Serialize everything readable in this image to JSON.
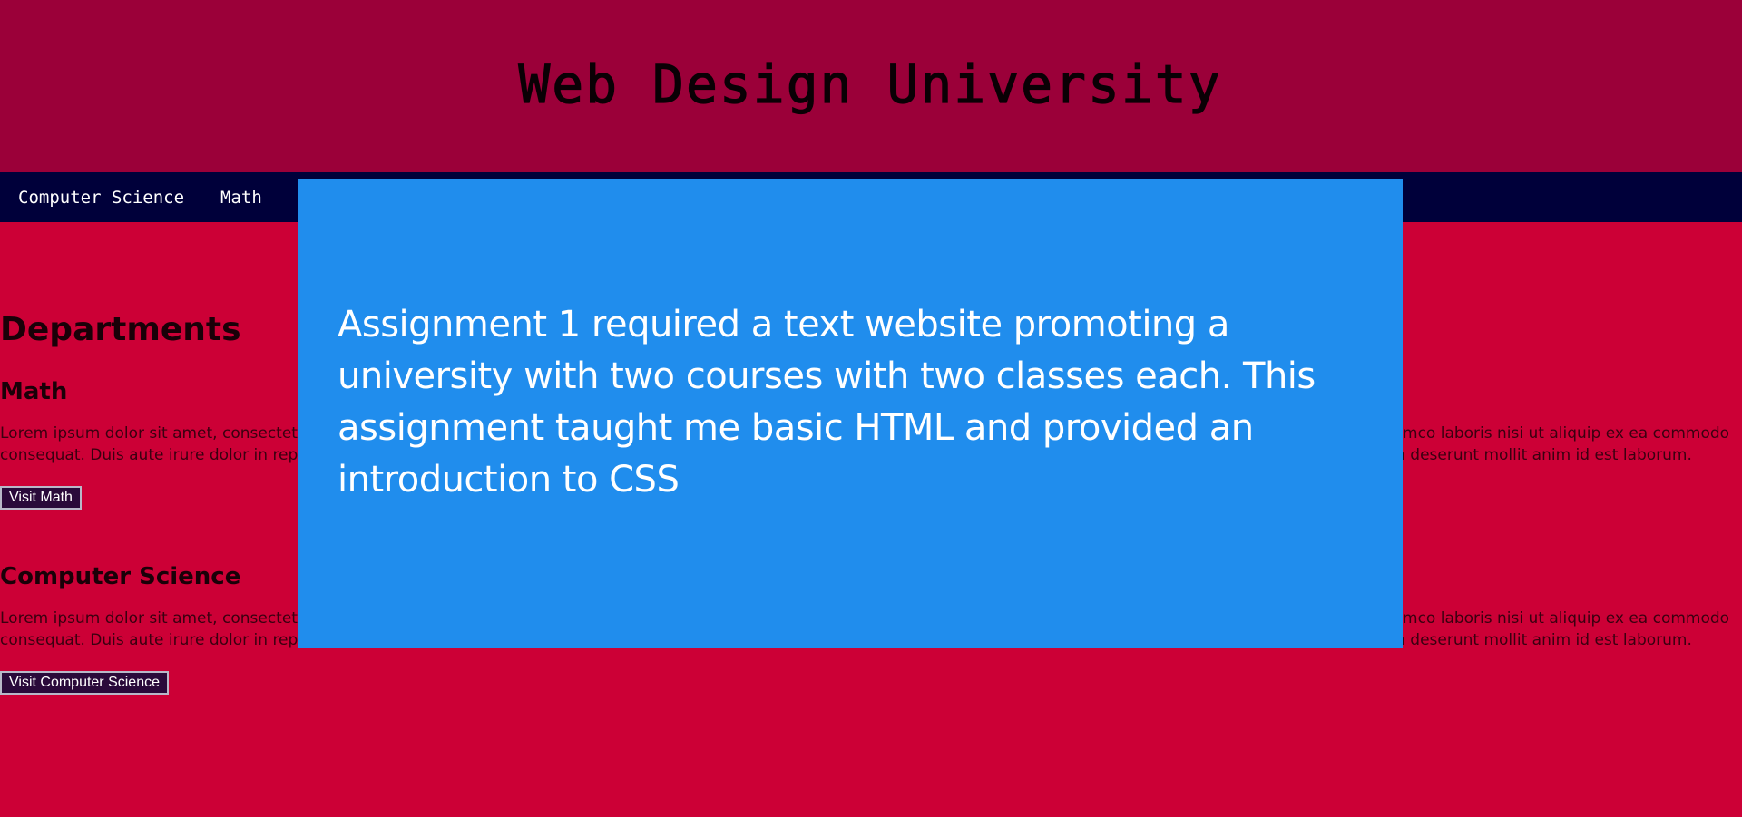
{
  "header": {
    "title": "Web Design University"
  },
  "nav": {
    "items": [
      {
        "label": "Computer Science"
      },
      {
        "label": "Math"
      }
    ]
  },
  "main": {
    "departments_heading": "Departments",
    "sections": [
      {
        "heading": "Math",
        "body": "Lorem ipsum dolor sit amet, consectetur adipiscing elit, sed do eiusmod tempor incididunt ut labore et dolore magna aliqua. Ut enim ad minim veniam, quis nostrud exercitation ullamco laboris nisi ut aliquip ex ea commodo consequat. Duis aute irure dolor in reprehenderit in voluptate velit esse cillum dolore eu fugiat nulla pariatur. Excepteur sint occaecat cupidatat non proident, sunt in culpa qui officia deserunt mollit anim id est laborum.",
        "button_label": "Visit Math"
      },
      {
        "heading": "Computer Science",
        "body": "Lorem ipsum dolor sit amet, consectetur adipiscing elit, sed do eiusmod tempor incididunt ut labore et dolore magna aliqua. Ut enim ad minim veniam, quis nostrud exercitation ullamco laboris nisi ut aliquip ex ea commodo consequat. Duis aute irure dolor in reprehenderit in voluptate velit esse cillum dolore eu fugiat nulla pariatur. Excepteur sint occaecat cupidatat non proident, sunt in culpa qui officia deserunt mollit anim id est laborum.",
        "button_label": "Visit Computer Science"
      }
    ]
  },
  "overlay": {
    "text": "Assignment 1 required a text website promoting a university with two courses with two classes each. This assignment taught me basic HTML and provided an introduction to CSS"
  },
  "colors": {
    "header_bg": "#9b0039",
    "page_bg": "#cc0036",
    "nav_bg": "#00003a",
    "overlay_bg": "#208ded",
    "button_bg": "#2a0a3a"
  }
}
